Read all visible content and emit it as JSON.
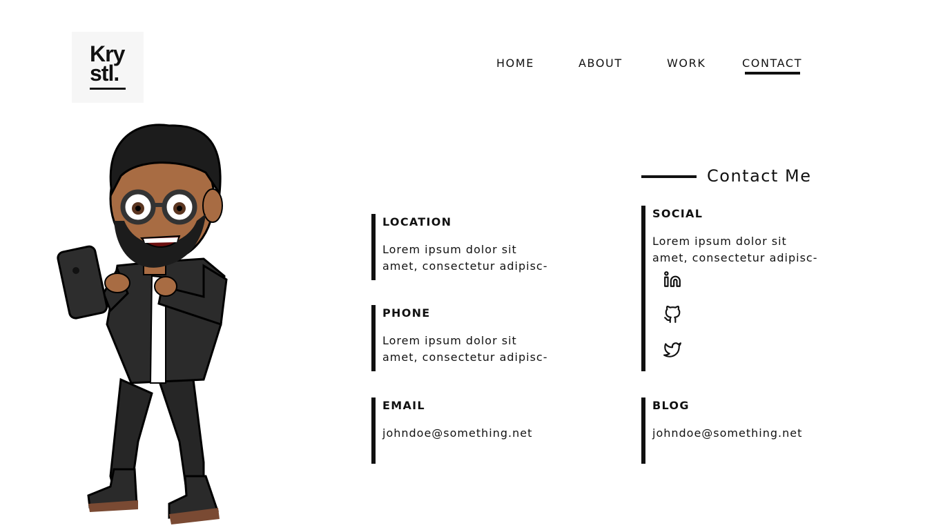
{
  "logo": {
    "line1": "Kry",
    "line2": "stl."
  },
  "nav": {
    "items": [
      {
        "label": "HOME"
      },
      {
        "label": "ABOUT"
      },
      {
        "label": "WORK"
      },
      {
        "label": "CONTACT",
        "active": true
      }
    ]
  },
  "contact": {
    "heading": "Contact Me",
    "location": {
      "title": "LOCATION",
      "line1": "Lorem ipsum dolor sit",
      "line2": "amet, consectetur adipisc-"
    },
    "phone": {
      "title": "PHONE",
      "line1": "Lorem ipsum dolor sit",
      "line2": "amet, consectetur adipisc-"
    },
    "email": {
      "title": "EMAIL",
      "value": "johndoe@something.net"
    },
    "social": {
      "title": "SOCIAL",
      "line1": "Lorem ipsum dolor sit",
      "line2": "amet, consectetur adipisc-",
      "icons": [
        "linkedin-icon",
        "github-icon",
        "twitter-icon"
      ]
    },
    "blog": {
      "title": "BLOG",
      "value": "johndoe@something.net"
    }
  },
  "colors": {
    "text": "#111111",
    "background": "#ffffff",
    "logo_bg": "#f6f6f6"
  }
}
